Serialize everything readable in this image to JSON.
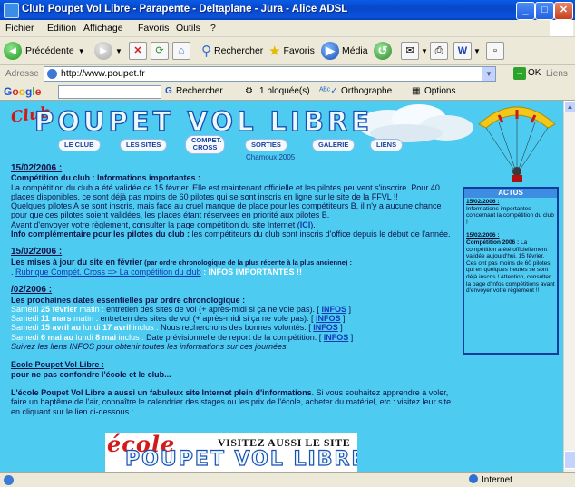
{
  "window": {
    "title": "Club Poupet Vol Libre - Parapente - Deltaplane - Jura - Alice ADSL",
    "buttons": {
      "minimize": "_",
      "maximize": "□",
      "close": "✕"
    }
  },
  "menu": [
    "Fichier",
    "Edition",
    "Affichage",
    "Favoris",
    "Outils",
    "?"
  ],
  "toolbar": {
    "back": "Précédente",
    "search": "Rechercher",
    "favorites": "Favoris",
    "media": "Média"
  },
  "address": {
    "label": "Adresse",
    "url": "http://www.poupet.fr",
    "go": "OK",
    "links": "Liens"
  },
  "google": {
    "logo": "Google",
    "search_btn": "Rechercher",
    "blocked": "1 bloquée(s)",
    "spell": "Orthographe",
    "options": "Options"
  },
  "banner": {
    "club": "Club",
    "title": "POUPET VOL LIBRE",
    "nav": [
      "LE CLUB",
      "LES SITES",
      "COMPET. CROSS",
      "SORTIES",
      "GALERIE",
      "LIENS"
    ],
    "chamoux": "Chamoux 2005"
  },
  "actus": {
    "header": "ACTUS",
    "items": [
      {
        "date": "15/02/2006 :",
        "text": "Informations importantes concernant la compétition du club !"
      },
      {
        "date": "15/02/2006 :",
        "lead": "Compétition 2006 :",
        "text": " La compétition a été officiellement validée aujourd'hui, 15 février. Ces ont pas moins de 60 pilotes qui en quelques heures se sont déjà inscris ! Attention, consulter la page d'infos compétitions avant d'envoyer votre règlement !!"
      }
    ]
  },
  "sections": {
    "s1": {
      "date": "15/02/2006 :",
      "heading": "Compétition du club : Informations importantes :",
      "p1": "La compétition du club a été validée ce 15 février. Elle est maintenant officielle et les pilotes peuvent s'inscrire. Pour 40 places disponibles, ce sont déjà pas moins de 60 pilotes qui se sont inscris en ligne sur le site de la FFVL !!",
      "p2": "Quelques pilotes A se sont inscris, mais face au cruel manque de place pour les compétiteurs B, il n'y a aucune chance pour que ces pilotes soient validées, les places étant réservées en priorité aux pilotes B.",
      "p3_pre": "Avant d'envoyer votre règlement, consulter la page compétition du site Internet (",
      "p3_link": "ICI",
      "p3_post": ").",
      "p4_lead": "Info complémentaire pour les pilotes du club :",
      "p4": " les compétiteurs du club sont inscris d'office depuis le début de l'année."
    },
    "s2": {
      "date": "15/02/2006 :",
      "heading": "Les mises à jour du site en février",
      "note": " (par ordre chronologique de la plus récente à la plus ancienne) :",
      "link": "Rubrique Compét. Cross => La compétition du club",
      "tag": " : INFOS IMPORTANTES !!"
    },
    "s3": {
      "date": "/02/2006 :",
      "heading": "Les prochaines dates essentielles par ordre chronologique :",
      "rows": [
        {
          "pre": "Samedi ",
          "d1": "25 février",
          "mid": " matin : ",
          "txt": "entretien des sites de vol (+ après-midi si ça ne vole pas). [ ",
          "link": "INFOS",
          "end": " ]"
        },
        {
          "pre": "Samedi ",
          "d1": "11 mars",
          "mid": " matin : ",
          "txt": "entretien des sites de vol (+ après-midi si ça ne vole pas). [ ",
          "link": "INFOS",
          "end": " ]"
        },
        {
          "pre": "Samedi ",
          "d1": "15 avril au",
          "mid": " lundi ",
          "d2": "17 avril",
          "mid2": " inclus : ",
          "txt": "Nous recherchons des bonnes volontés. [ ",
          "link": "INFOS",
          "end": " ]"
        },
        {
          "pre": "Samedi ",
          "d1": "6 mai au",
          "mid": " lundi ",
          "d2": "8 mai",
          "mid2": " inclus : ",
          "txt": "Date prévisionnelle de report de la compétition. [ ",
          "link": "INFOS",
          "end": " ]"
        }
      ],
      "footer": "Suivez les liens INFOS pour obtenir toutes les informations sur ces journées."
    },
    "s4": {
      "heading": "Ecole Poupet Vol Libre :",
      "sub": "pour ne pas confondre l'école et le club..."
    },
    "s5": {
      "lead": "L'école Poupet Vol Libre a aussi un fabuleux site Internet plein d'informations",
      "text": ". Si vous souhaitez apprendre à voler, faire un baptême de l'air, connaître le calendrier des stages ou les prix de l'école, acheter du matériel, etc : visitez leur site en cliquant sur le lien ci-dessous :"
    }
  },
  "bottom_banner": {
    "ecole": "école",
    "visitez": "VISITEZ AUSSI LE SITE",
    "name": "POUPET VOL LIBRE"
  },
  "status": {
    "zone": "Internet"
  }
}
